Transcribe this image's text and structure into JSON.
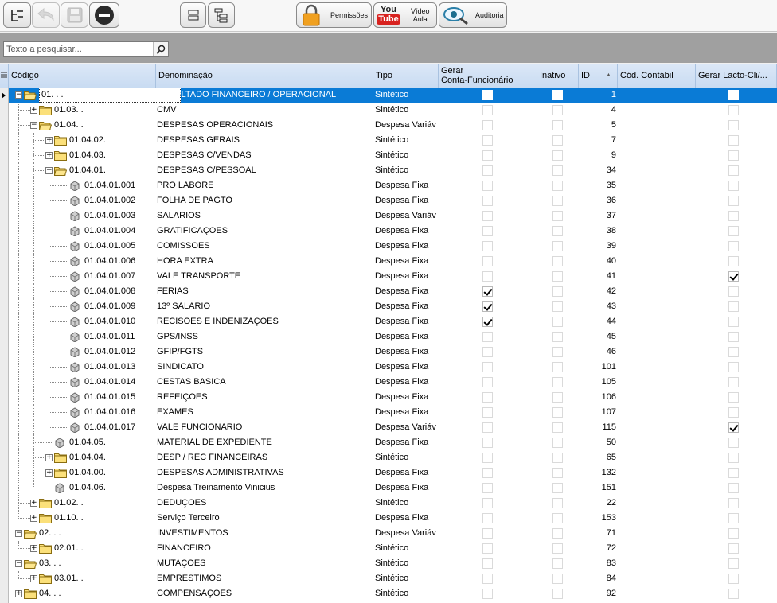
{
  "toolbar": {
    "permissoes_label": "Permissões",
    "youtube_top": "You",
    "youtube_bottom": "Tube",
    "video_label_1": "Vídeo",
    "video_label_2": "Aula",
    "auditoria_label": "Auditoria"
  },
  "search": {
    "placeholder": "Texto a pesquisar..."
  },
  "columns": {
    "codigo": "Código",
    "denominacao": "Denominação",
    "tipo": "Tipo",
    "gerar_line1": "Gerar",
    "gerar_line2": "Conta-Funcionário",
    "inativo": "Inativo",
    "id": "ID",
    "sort_indicator": "▲",
    "cod_contabil": "Cód. Contábil",
    "gerar_lacto": "Gerar Lacto-Cli/..."
  },
  "rows": [
    {
      "level": 0,
      "node": "folder-open",
      "exp": "-",
      "codigo": "01. . .",
      "denominacao": "RESULTADO FINANCEIRO / OPERACIONAL",
      "tipo": "Sintético",
      "gerar": false,
      "inativo": false,
      "id": "1",
      "lacto": false,
      "selected": true
    },
    {
      "level": 1,
      "node": "folder",
      "exp": "+",
      "codigo": "01.03. .",
      "denominacao": "CMV",
      "tipo": "Sintético",
      "gerar": false,
      "inativo": false,
      "id": "4",
      "lacto": false
    },
    {
      "level": 1,
      "node": "folder-open",
      "exp": "-",
      "codigo": "01.04. .",
      "denominacao": "DESPESAS OPERACIONAIS",
      "tipo": "Despesa Variáv",
      "gerar": false,
      "inativo": false,
      "id": "5",
      "lacto": false
    },
    {
      "level": 2,
      "node": "folder",
      "exp": "+",
      "codigo": "01.04.02.",
      "denominacao": "DESPESAS GERAIS",
      "tipo": "Sintético",
      "gerar": false,
      "inativo": false,
      "id": "7",
      "lacto": false
    },
    {
      "level": 2,
      "node": "folder",
      "exp": "+",
      "codigo": "01.04.03.",
      "denominacao": "DESPESAS C/VENDAS",
      "tipo": "Sintético",
      "gerar": false,
      "inativo": false,
      "id": "9",
      "lacto": false
    },
    {
      "level": 2,
      "node": "folder-open",
      "exp": "-",
      "codigo": "01.04.01.",
      "denominacao": "DESPESAS C/PESSOAL",
      "tipo": "Sintético",
      "gerar": false,
      "inativo": false,
      "id": "34",
      "lacto": false
    },
    {
      "level": 3,
      "node": "leaf",
      "codigo": "01.04.01.001",
      "denominacao": "PRO LABORE",
      "tipo": "Despesa Fixa",
      "gerar": false,
      "inativo": false,
      "id": "35",
      "lacto": false
    },
    {
      "level": 3,
      "node": "leaf",
      "codigo": "01.04.01.002",
      "denominacao": "FOLHA DE PAGTO",
      "tipo": "Despesa Fixa",
      "gerar": false,
      "inativo": false,
      "id": "36",
      "lacto": false
    },
    {
      "level": 3,
      "node": "leaf",
      "codigo": "01.04.01.003",
      "denominacao": "SALARIOS",
      "tipo": "Despesa Variáv",
      "gerar": false,
      "inativo": false,
      "id": "37",
      "lacto": false
    },
    {
      "level": 3,
      "node": "leaf",
      "codigo": "01.04.01.004",
      "denominacao": "GRATIFICAÇOES",
      "tipo": "Despesa Fixa",
      "gerar": false,
      "inativo": false,
      "id": "38",
      "lacto": false
    },
    {
      "level": 3,
      "node": "leaf",
      "codigo": "01.04.01.005",
      "denominacao": "COMISSOES",
      "tipo": "Despesa Fixa",
      "gerar": false,
      "inativo": false,
      "id": "39",
      "lacto": false
    },
    {
      "level": 3,
      "node": "leaf",
      "codigo": "01.04.01.006",
      "denominacao": "HORA EXTRA",
      "tipo": "Despesa Fixa",
      "gerar": false,
      "inativo": false,
      "id": "40",
      "lacto": false
    },
    {
      "level": 3,
      "node": "leaf",
      "codigo": "01.04.01.007",
      "denominacao": "VALE TRANSPORTE",
      "tipo": "Despesa Fixa",
      "gerar": false,
      "inativo": false,
      "id": "41",
      "lacto": true
    },
    {
      "level": 3,
      "node": "leaf",
      "codigo": "01.04.01.008",
      "denominacao": "FERIAS",
      "tipo": "Despesa Fixa",
      "gerar": true,
      "inativo": false,
      "id": "42",
      "lacto": false
    },
    {
      "level": 3,
      "node": "leaf",
      "codigo": "01.04.01.009",
      "denominacao": "13º SALARIO",
      "tipo": "Despesa Fixa",
      "gerar": true,
      "inativo": false,
      "id": "43",
      "lacto": false
    },
    {
      "level": 3,
      "node": "leaf",
      "codigo": "01.04.01.010",
      "denominacao": "RECISOES E INDENIZAÇOES",
      "tipo": "Despesa Fixa",
      "gerar": true,
      "inativo": false,
      "id": "44",
      "lacto": false
    },
    {
      "level": 3,
      "node": "leaf",
      "codigo": "01.04.01.011",
      "denominacao": "GPS/INSS",
      "tipo": "Despesa Fixa",
      "gerar": false,
      "inativo": false,
      "id": "45",
      "lacto": false
    },
    {
      "level": 3,
      "node": "leaf",
      "codigo": "01.04.01.012",
      "denominacao": "GFIP/FGTS",
      "tipo": "Despesa Fixa",
      "gerar": false,
      "inativo": false,
      "id": "46",
      "lacto": false
    },
    {
      "level": 3,
      "node": "leaf",
      "codigo": "01.04.01.013",
      "denominacao": "SINDICATO",
      "tipo": "Despesa Fixa",
      "gerar": false,
      "inativo": false,
      "id": "101",
      "lacto": false
    },
    {
      "level": 3,
      "node": "leaf",
      "codigo": "01.04.01.014",
      "denominacao": "CESTAS BASICA",
      "tipo": "Despesa Fixa",
      "gerar": false,
      "inativo": false,
      "id": "105",
      "lacto": false
    },
    {
      "level": 3,
      "node": "leaf",
      "codigo": "01.04.01.015",
      "denominacao": "REFEIÇOES",
      "tipo": "Despesa Fixa",
      "gerar": false,
      "inativo": false,
      "id": "106",
      "lacto": false
    },
    {
      "level": 3,
      "node": "leaf",
      "codigo": "01.04.01.016",
      "denominacao": "EXAMES",
      "tipo": "Despesa Fixa",
      "gerar": false,
      "inativo": false,
      "id": "107",
      "lacto": false
    },
    {
      "level": 3,
      "node": "leaf",
      "codigo": "01.04.01.017",
      "denominacao": "VALE FUNCIONARIO",
      "tipo": "Despesa Variáv",
      "gerar": false,
      "inativo": false,
      "id": "115",
      "lacto": true
    },
    {
      "level": 2,
      "node": "leaf",
      "codigo": "01.04.05.",
      "denominacao": "MATERIAL DE EXPEDIENTE",
      "tipo": "Despesa Fixa",
      "gerar": false,
      "inativo": false,
      "id": "50",
      "lacto": false
    },
    {
      "level": 2,
      "node": "folder",
      "exp": "+",
      "codigo": "01.04.04.",
      "denominacao": "DESP / REC FINANCEIRAS",
      "tipo": "Sintético",
      "gerar": false,
      "inativo": false,
      "id": "65",
      "lacto": false
    },
    {
      "level": 2,
      "node": "folder",
      "exp": "+",
      "codigo": "01.04.00.",
      "denominacao": "DESPESAS ADMINISTRATIVAS",
      "tipo": "Despesa Fixa",
      "gerar": false,
      "inativo": false,
      "id": "132",
      "lacto": false
    },
    {
      "level": 2,
      "node": "leaf",
      "codigo": "01.04.06.",
      "denominacao": "Despesa Treinamento Vinicius",
      "tipo": "Despesa Fixa",
      "gerar": false,
      "inativo": false,
      "id": "151",
      "lacto": false
    },
    {
      "level": 1,
      "node": "folder",
      "exp": "+",
      "codigo": "01.02. .",
      "denominacao": "DEDUÇOES",
      "tipo": "Sintético",
      "gerar": false,
      "inativo": false,
      "id": "22",
      "lacto": false
    },
    {
      "level": 1,
      "node": "folder",
      "exp": "+",
      "codigo": "01.10. .",
      "denominacao": "Serviço Terceiro",
      "tipo": "Despesa Fixa",
      "gerar": false,
      "inativo": false,
      "id": "153",
      "lacto": false
    },
    {
      "level": 0,
      "node": "folder-open",
      "exp": "-",
      "codigo": "02. . .",
      "denominacao": "INVESTIMENTOS",
      "tipo": "Despesa Variáv",
      "gerar": false,
      "inativo": false,
      "id": "71",
      "lacto": false
    },
    {
      "level": 1,
      "node": "folder",
      "exp": "+",
      "codigo": "02.01. .",
      "denominacao": "FINANCEIRO",
      "tipo": "Sintético",
      "gerar": false,
      "inativo": false,
      "id": "72",
      "lacto": false
    },
    {
      "level": 0,
      "node": "folder-open",
      "exp": "-",
      "codigo": "03. . .",
      "denominacao": "MUTAÇOES",
      "tipo": "Sintético",
      "gerar": false,
      "inativo": false,
      "id": "83",
      "lacto": false
    },
    {
      "level": 1,
      "node": "folder",
      "exp": "+",
      "codigo": "03.01. .",
      "denominacao": "EMPRESTIMOS",
      "tipo": "Sintético",
      "gerar": false,
      "inativo": false,
      "id": "84",
      "lacto": false
    },
    {
      "level": 0,
      "node": "folder",
      "exp": "+",
      "codigo": "04. . .",
      "denominacao": "COMPENSAÇOES",
      "tipo": "Sintético",
      "gerar": false,
      "inativo": false,
      "id": "92",
      "lacto": false
    }
  ]
}
